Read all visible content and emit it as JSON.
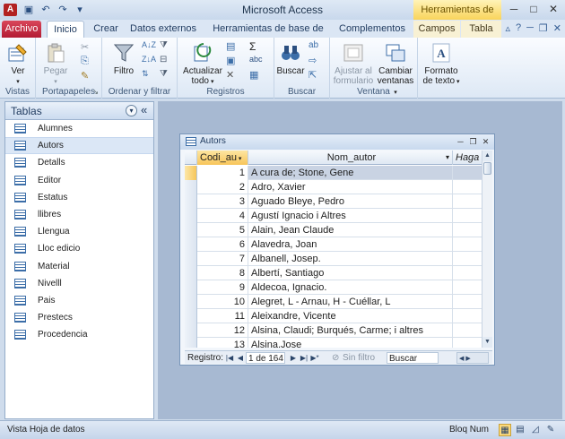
{
  "titlebar": {
    "title": "Microsoft Access",
    "context_tools": "Herramientas de tabla",
    "qat": [
      "save-icon",
      "undo-icon",
      "redo-icon",
      "customize-icon"
    ],
    "minimize": "─",
    "maximize": "□",
    "close": "✕"
  },
  "tabs": {
    "archivo": "Archivo",
    "inicio": "Inicio",
    "crear": "Crear",
    "datos_externos": "Datos externos",
    "herramientas_bd": "Herramientas de base de datos",
    "complementos": "Complementos",
    "campos": "Campos",
    "tabla": "Tabla"
  },
  "ribbon": {
    "vistas": {
      "label": "Vistas",
      "ver": "Ver"
    },
    "portapapeles": {
      "label": "Portapapeles",
      "pegar": "Pegar"
    },
    "ordenar": {
      "label": "Ordenar y filtrar",
      "filtro": "Filtro"
    },
    "registros": {
      "label": "Registros",
      "actualizar": "Actualizar",
      "actualizar2": "todo"
    },
    "buscar": {
      "label": "Buscar",
      "buscar_btn": "Buscar"
    },
    "ventana": {
      "label": "Ventana",
      "ajustar": "Ajustar al",
      "ajustar2": "formulario",
      "cambiar": "Cambiar",
      "cambiar2": "ventanas"
    },
    "formato": {
      "formato": "Formato",
      "formato2": "de texto"
    }
  },
  "nav": {
    "title": "Tablas",
    "menu_glyph": "▾",
    "collapse_glyph": "«",
    "items": [
      "Alumnes",
      "Autors",
      "Detalls",
      "Editor",
      "Estatus",
      "llibres",
      "Llengua",
      "Lloc edicio",
      "Material",
      "Nivelll",
      "Pais",
      "Prestecs",
      "Procedencia"
    ],
    "selected_index": 1
  },
  "table_window": {
    "title": "Autors",
    "columns": [
      "Codi_au",
      "Nom_autor",
      "Haga c"
    ],
    "rows": [
      {
        "id": "1",
        "name": "A cura de; Stone, Gene"
      },
      {
        "id": "2",
        "name": "Adro, Xavier"
      },
      {
        "id": "3",
        "name": "Aguado Bleye, Pedro"
      },
      {
        "id": "4",
        "name": "Agustí Ignacio i Altres"
      },
      {
        "id": "5",
        "name": "Alain, Jean Claude"
      },
      {
        "id": "6",
        "name": "Alavedra, Joan"
      },
      {
        "id": "7",
        "name": "Albanell, Josep."
      },
      {
        "id": "8",
        "name": "Albertí, Santiago"
      },
      {
        "id": "9",
        "name": "Aldecoa, Ignacio."
      },
      {
        "id": "10",
        "name": "Alegret, L - Arnau, H - Cuéllar, L"
      },
      {
        "id": "11",
        "name": "Aleixandre, Vicente"
      },
      {
        "id": "12",
        "name": "Alsina, Claudi; Burqués, Carme; i altres"
      },
      {
        "id": "13",
        "name": "Alsina,Jose"
      }
    ],
    "current_row": 0,
    "record_nav": {
      "label": "Registro:",
      "position": "1 de 164",
      "filter": "Sin filtro",
      "search_placeholder": "Buscar"
    }
  },
  "status": {
    "left": "Vista Hoja de datos",
    "num": "Bloq Num"
  },
  "colors": {
    "accent": "#b31b33",
    "context": "#f9d45b",
    "selection": "#c9d3e3"
  }
}
